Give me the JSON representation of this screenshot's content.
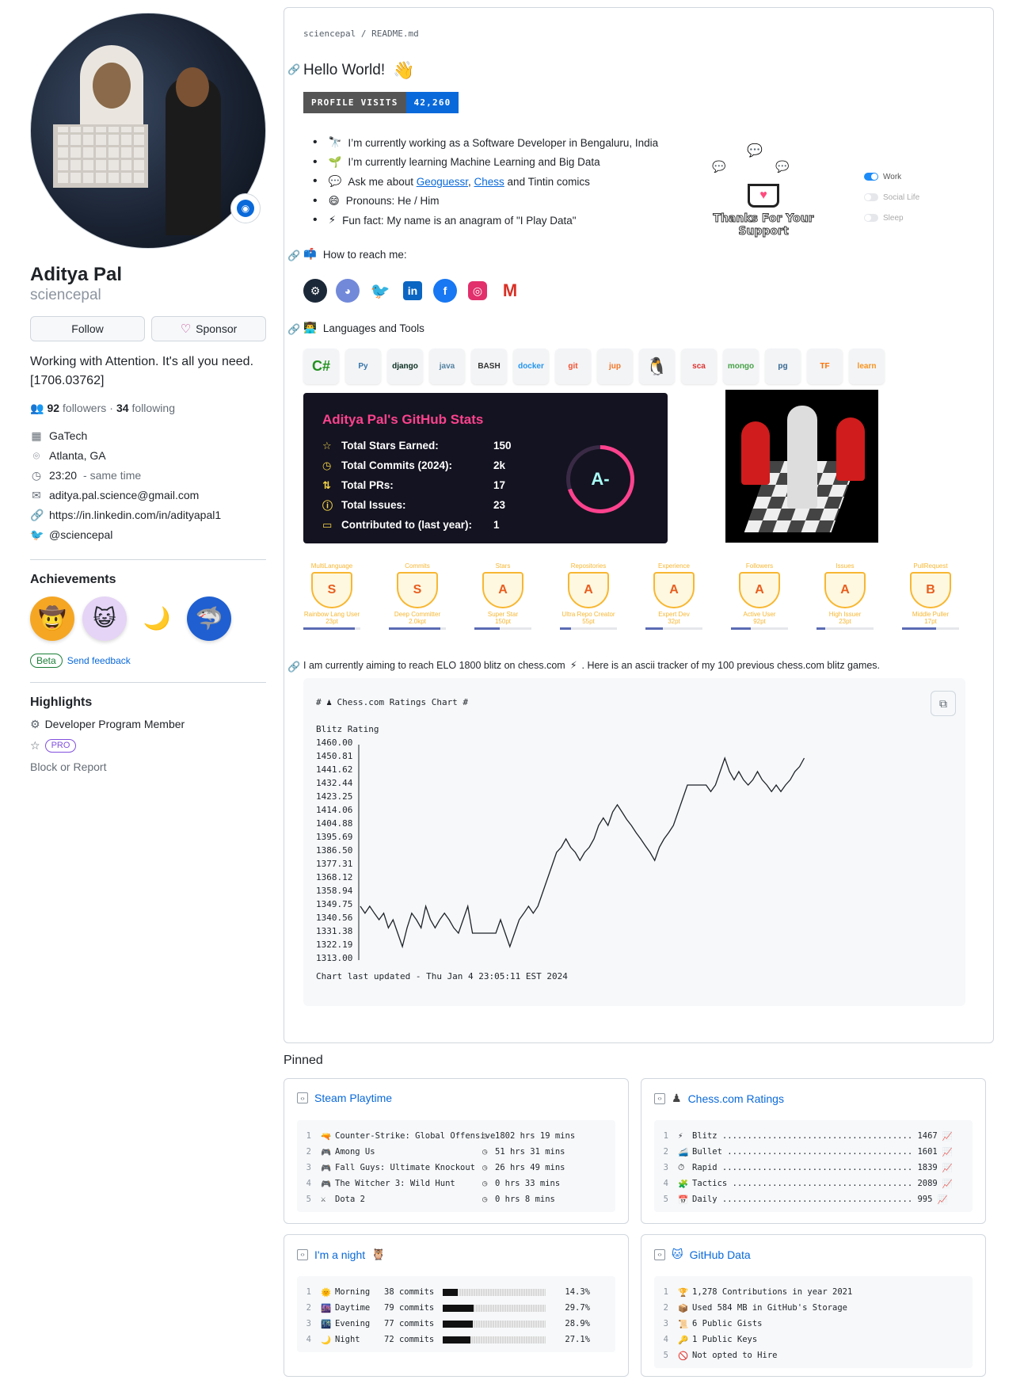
{
  "profile": {
    "name": "Aditya Pal",
    "login": "sciencepal",
    "follow_label": "Follow",
    "sponsor_label": "Sponsor",
    "bio": "Working with Attention. It's all you need. [1706.03762]",
    "followers_count": "92",
    "followers_label": "followers",
    "following_count": "34",
    "following_label": "following",
    "dot": "·",
    "meta": {
      "org": "GaTech",
      "location": "Atlanta, GA",
      "time": "23:20",
      "time_suffix": "- same time",
      "email": "aditya.pal.science@gmail.com",
      "linkedin": "https://in.linkedin.com/in/adityapal1",
      "twitter": "@sciencepal"
    }
  },
  "achievements": {
    "title": "Achievements",
    "beta": "Beta",
    "feedback": "Send feedback"
  },
  "highlights": {
    "title": "Highlights",
    "dev_program": "Developer Program Member",
    "pro": "PRO",
    "block": "Block or Report"
  },
  "readme": {
    "path_user": "sciencepal",
    "path_sep": "/",
    "path_file": "README.md",
    "hello": "Hello World!",
    "hello_emoji": "👋",
    "badge_label": "PROFILE VISITS",
    "badge_value": "42,260",
    "bullets": [
      {
        "emoji": "🔭",
        "text": "I’m currently working as a Software Developer in Bengaluru, India"
      },
      {
        "emoji": "🌱",
        "text": "I’m currently learning Machine Learning and Big Data"
      },
      {
        "emoji": "💬",
        "text_pre": "Ask me about ",
        "link1": "Geoguessr",
        "comma": ", ",
        "link2": "Chess",
        "text_post": " and Tintin comics"
      },
      {
        "emoji": "😄",
        "text": "Pronouns: He / Him"
      },
      {
        "emoji": "⚡",
        "text": "Fun fact: My name is an anagram of \"I Play Data\""
      }
    ],
    "thanks_text": "Thanks For Your Support",
    "toggles": [
      "Work",
      "Social Life",
      "Sleep"
    ],
    "reach_title": "How to reach me:",
    "langs_title": "Languages and Tools",
    "tools": [
      "C#",
      "Py",
      "django",
      "java",
      "BASH",
      "docker",
      "git",
      "jup",
      "🐧",
      "sca",
      "mongo",
      "pg",
      "TF",
      "learn"
    ],
    "elo_text_pre": "I am currently aiming to reach ELO 1800 blitz on chess.com",
    "elo_text_post": ". Here is an ascii tracker of my 100 previous chess.com blitz games."
  },
  "stats_card": {
    "title": "Aditya Pal's GitHub Stats",
    "rows": [
      {
        "label": "Total Stars Earned:",
        "value": "150"
      },
      {
        "label": "Total Commits (2024):",
        "value": "2k"
      },
      {
        "label": "Total PRs:",
        "value": "17"
      },
      {
        "label": "Total Issues:",
        "value": "23"
      },
      {
        "label": "Contributed to (last year):",
        "value": "1"
      }
    ],
    "grade": "A-"
  },
  "trophies": [
    {
      "title": "MultiLanguage",
      "rank": "S",
      "sub": "Rainbow Lang User",
      "pts": "23pt",
      "progress": 0.9
    },
    {
      "title": "Commits",
      "rank": "S",
      "sub": "Deep Committer",
      "pts": "2.0kpt",
      "progress": 0.9
    },
    {
      "title": "Stars",
      "rank": "A",
      "sub": "Super Star",
      "pts": "150pt",
      "progress": 0.45
    },
    {
      "title": "Repositories",
      "rank": "A",
      "sub": "Ultra Repo Creator",
      "pts": "55pt",
      "progress": 0.2
    },
    {
      "title": "Experience",
      "rank": "A",
      "sub": "Expert Dev",
      "pts": "32pt",
      "progress": 0.3
    },
    {
      "title": "Followers",
      "rank": "A",
      "sub": "Active User",
      "pts": "92pt",
      "progress": 0.35
    },
    {
      "title": "Issues",
      "rank": "A",
      "sub": "High Issuer",
      "pts": "23pt",
      "progress": 0.15
    },
    {
      "title": "PullRequest",
      "rank": "B",
      "sub": "Middle Puller",
      "pts": "17pt",
      "progress": 0.6
    }
  ],
  "chart_data": {
    "type": "line",
    "title": "# ♟ Chess.com Ratings Chart #",
    "ylabel": "Blitz Rating",
    "ticks": [
      "1460.00",
      "1450.81",
      "1441.62",
      "1432.44",
      "1423.25",
      "1414.06",
      "1404.88",
      "1395.69",
      "1386.50",
      "1377.31",
      "1368.12",
      "1358.94",
      "1349.75",
      "1340.56",
      "1331.38",
      "1322.19",
      "1313.00"
    ],
    "ylim": [
      1313.0,
      1460.0
    ],
    "values": [
      1349.75,
      1345,
      1349.75,
      1345,
      1340.56,
      1345,
      1335,
      1340.56,
      1331.38,
      1322.19,
      1335,
      1345,
      1340.56,
      1335,
      1349.75,
      1340.56,
      1335,
      1340.56,
      1345,
      1340.56,
      1335,
      1331.38,
      1340.56,
      1349.75,
      1331.38,
      1331.38,
      1331.38,
      1331.38,
      1331.38,
      1331.38,
      1340.56,
      1331.38,
      1322.19,
      1331.38,
      1340.56,
      1345,
      1349.75,
      1345,
      1349.75,
      1358.94,
      1368.12,
      1377.31,
      1386.5,
      1390,
      1395.69,
      1390,
      1386.5,
      1381,
      1386.5,
      1390,
      1395.69,
      1404.88,
      1410,
      1404.88,
      1414.06,
      1419,
      1414.06,
      1409,
      1404.88,
      1400,
      1395.69,
      1391,
      1386.5,
      1381,
      1390,
      1395.69,
      1400,
      1404.88,
      1414.06,
      1423.25,
      1432.44,
      1432.44,
      1432.44,
      1432.44,
      1432.44,
      1428,
      1432.44,
      1441.62,
      1450.81,
      1441.62,
      1436,
      1441.62,
      1436,
      1432.44,
      1436,
      1441.62,
      1436,
      1432.44,
      1428,
      1432.44,
      1428,
      1432.44,
      1436,
      1441.62,
      1445,
      1450.81
    ],
    "footer": "Chart last updated - Thu Jan  4 23:05:11 EST 2024"
  },
  "pinned": {
    "title": "Pinned",
    "steam": {
      "title": "Steam Playtime",
      "rows": [
        {
          "n": "1",
          "icon": "🔫",
          "game": "Counter-Strike: Global Offensive",
          "time": "1802 hrs 19 mins"
        },
        {
          "n": "2",
          "icon": "🎮",
          "game": "Among Us",
          "time": "51 hrs 31 mins"
        },
        {
          "n": "3",
          "icon": "🎮",
          "game": "Fall Guys: Ultimate Knockout",
          "time": "26 hrs 49 mins"
        },
        {
          "n": "4",
          "icon": "🎮",
          "game": "The Witcher 3: Wild Hunt",
          "time": "0 hrs 33 mins"
        },
        {
          "n": "5",
          "icon": "⚔",
          "game": "Dota 2",
          "time": "0 hrs 8 mins"
        }
      ]
    },
    "chess": {
      "title": "Chess.com Ratings",
      "rows": [
        {
          "n": "1",
          "icon": "⚡",
          "text": "Blitz ...................................... 1467"
        },
        {
          "n": "2",
          "icon": "🚄",
          "text": "Bullet ..................................... 1601"
        },
        {
          "n": "3",
          "icon": "⏱",
          "text": "Rapid ...................................... 1839"
        },
        {
          "n": "4",
          "icon": "🧩",
          "text": "Tactics .................................... 2089"
        },
        {
          "n": "5",
          "icon": "📅",
          "text": "Daily ...................................... 995"
        }
      ]
    },
    "night": {
      "title": "I'm a night",
      "emoji": "🦉",
      "rows": [
        {
          "n": "1",
          "icon": "🌞",
          "label": "Morning",
          "commits": "38 commits",
          "pct": "14.3%",
          "frac": 0.143
        },
        {
          "n": "2",
          "icon": "🌆",
          "label": "Daytime",
          "commits": "79 commits",
          "pct": "29.7%",
          "frac": 0.297
        },
        {
          "n": "3",
          "icon": "🌃",
          "label": "Evening",
          "commits": "77 commits",
          "pct": "28.9%",
          "frac": 0.289
        },
        {
          "n": "4",
          "icon": "🌙",
          "label": "Night",
          "commits": "72 commits",
          "pct": "27.1%",
          "frac": 0.271
        }
      ]
    },
    "ghdata": {
      "title": "GitHub Data",
      "rows": [
        {
          "n": "1",
          "icon": "🏆",
          "text": "1,278 Contributions in year 2021"
        },
        {
          "n": "2",
          "icon": "📦",
          "text": "Used 584 MB in GitHub's Storage"
        },
        {
          "n": "3",
          "icon": "📜",
          "text": "6 Public Gists"
        },
        {
          "n": "4",
          "icon": "🔑",
          "text": "1 Public Keys"
        },
        {
          "n": "5",
          "icon": "🚫",
          "text": "Not opted to Hire"
        }
      ]
    }
  }
}
